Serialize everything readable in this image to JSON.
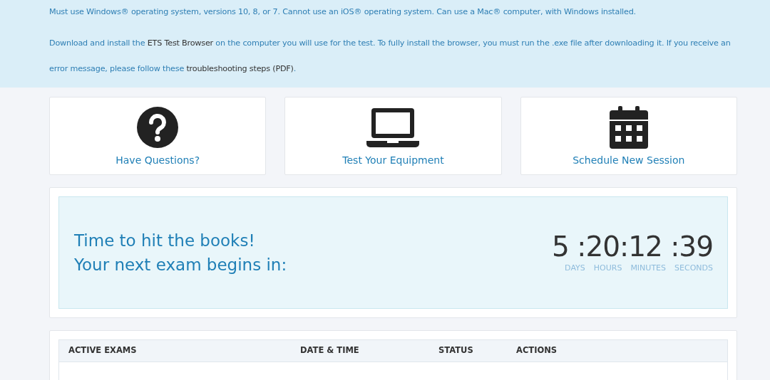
{
  "notice": {
    "paragraphs": [
      {
        "parts": [
          {
            "text": "Must use Windows® operating system, versions 10, 8, or 7. Cannot use an iOS® operating system. Can use a Mac® computer, with Windows installed."
          }
        ]
      },
      {
        "parts": [
          {
            "text": "Download and install the "
          },
          {
            "link": "ETS Test Browser"
          },
          {
            "text": " on the computer you will use for the test. To fully install the browser, you must run the .exe file after downloading it. If you receive an error message, please follow these "
          },
          {
            "link": "troubleshooting steps (PDF)"
          },
          {
            "text": "."
          }
        ]
      }
    ]
  },
  "tiles": [
    {
      "kind": "question",
      "label": "Have Questions?"
    },
    {
      "kind": "laptop",
      "label": "Test Your Equipment"
    },
    {
      "kind": "calendar",
      "label": "Schedule New Session"
    }
  ],
  "countdown": {
    "message": [
      "Time to hit the books!",
      "Your next exam begins in:"
    ],
    "display": "5 :20:12 :39",
    "units": [
      "DAYS",
      "HOURS",
      "MINUTES",
      "SECONDS"
    ]
  },
  "table": {
    "columns": [
      "ACTIVE EXAMS",
      "DATE & TIME",
      "STATUS",
      "ACTIONS"
    ]
  }
}
